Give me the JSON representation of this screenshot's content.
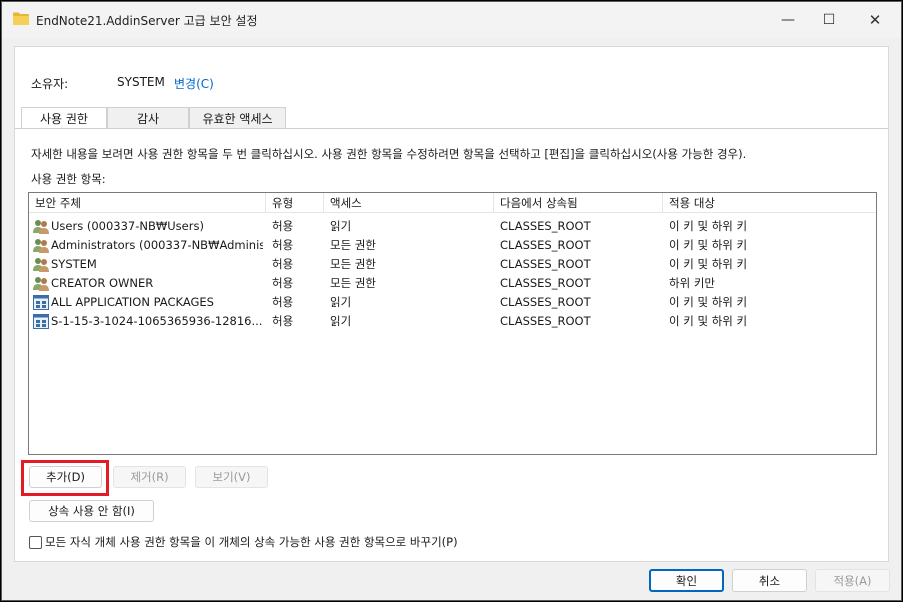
{
  "window": {
    "title": "EndNote21.AddinServer 고급 보안 설정",
    "minimize_glyph": "—",
    "maximize_glyph": "☐",
    "close_glyph": "✕"
  },
  "owner": {
    "label": "소유자:",
    "value": "SYSTEM",
    "change_label": "변경(C)"
  },
  "tabs": [
    {
      "label": "사용 권한",
      "active": true
    },
    {
      "label": "감사",
      "active": false
    },
    {
      "label": "유효한 액세스",
      "active": false
    }
  ],
  "description": "자세한 내용을 보려면 사용 권한 항목을 두 번 클릭하십시오. 사용 권한 항목을 수정하려면 항목을 선택하고 [편집]을 클릭하십시오(사용 가능한 경우).",
  "list_label": "사용 권한 항목:",
  "columns": [
    "보안 주체",
    "유형",
    "액세스",
    "다음에서 상속됨",
    "적용 대상"
  ],
  "entries": [
    {
      "icon": "user-group-icon",
      "principal": "Users (000337-NB₩Users)",
      "type": "허용",
      "access": "읽기",
      "inherited": "CLASSES_ROOT",
      "applies": "이 키 및 하위 키"
    },
    {
      "icon": "user-group-icon",
      "principal": "Administrators (000337-NB₩Adminis...",
      "type": "허용",
      "access": "모든 권한",
      "inherited": "CLASSES_ROOT",
      "applies": "이 키 및 하위 키"
    },
    {
      "icon": "user-group-icon",
      "principal": "SYSTEM",
      "type": "허용",
      "access": "모든 권한",
      "inherited": "CLASSES_ROOT",
      "applies": "이 키 및 하위 키"
    },
    {
      "icon": "user-group-icon",
      "principal": "CREATOR OWNER",
      "type": "허용",
      "access": "모든 권한",
      "inherited": "CLASSES_ROOT",
      "applies": "하위 키만"
    },
    {
      "icon": "app-package-icon",
      "principal": "ALL APPLICATION PACKAGES",
      "type": "허용",
      "access": "읽기",
      "inherited": "CLASSES_ROOT",
      "applies": "이 키 및 하위 키"
    },
    {
      "icon": "app-package-icon",
      "principal": "S-1-15-3-1024-1065365936-12816...",
      "type": "허용",
      "access": "읽기",
      "inherited": "CLASSES_ROOT",
      "applies": "이 키 및 하위 키"
    }
  ],
  "actions": {
    "add": "추가(D)",
    "remove": "제거(R)",
    "view": "보기(V)",
    "disable_inheritance": "상속 사용 안 함(I)",
    "replace_child_label": "모든 자식 개체 사용 권한 항목을 이 개체의 상속 가능한 사용 권한 항목으로 바꾸기(P)"
  },
  "footer": {
    "ok": "확인",
    "cancel": "취소",
    "apply": "적용(A)"
  },
  "colors": {
    "accent": "#0067c0",
    "link": "#0066cc",
    "highlight": "#e21b24",
    "folder": "#f2c94c"
  }
}
